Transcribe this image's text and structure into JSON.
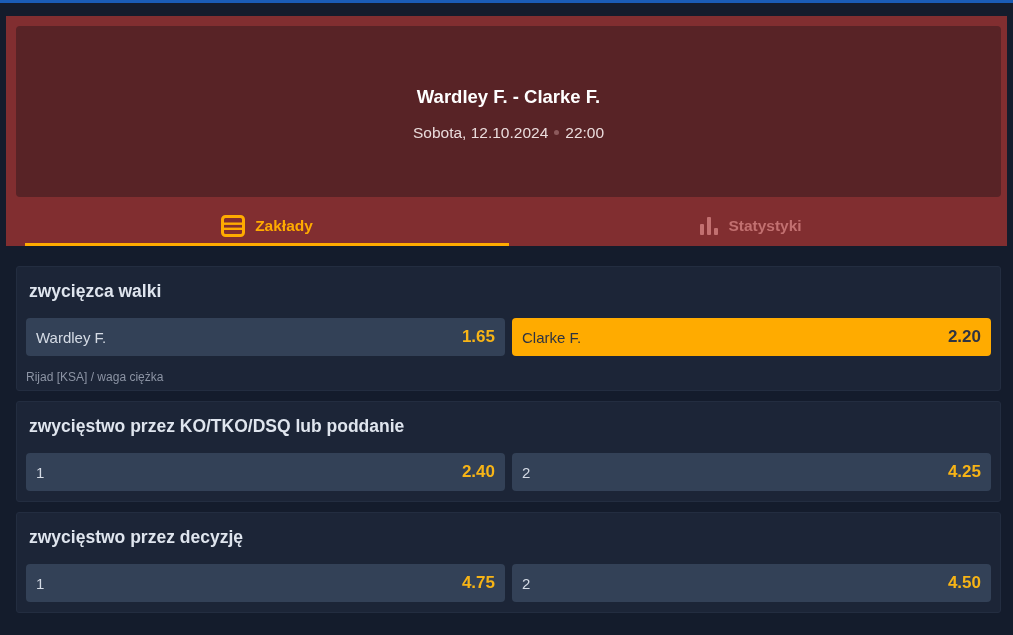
{
  "event": {
    "title": "Wardley F. - Clarke F.",
    "date": "Sobota, 12.10.2024",
    "time": "22:00"
  },
  "tabs": [
    {
      "kind": "bets",
      "label": "Zakłady",
      "selected": true
    },
    {
      "kind": "stats",
      "label": "Statystyki",
      "selected": false
    }
  ],
  "markets": [
    {
      "title": "zwycięzca walki",
      "options": [
        {
          "label": "Wardley F.",
          "odds": "1.65",
          "selected": false
        },
        {
          "label": "Clarke F.",
          "odds": "2.20",
          "selected": true
        }
      ],
      "note": "Rijad [KSA] / waga ciężka"
    },
    {
      "title": "zwycięstwo przez KO/TKO/DSQ lub poddanie",
      "options": [
        {
          "label": "1",
          "odds": "2.40",
          "selected": false
        },
        {
          "label": "2",
          "odds": "4.25",
          "selected": false
        }
      ]
    },
    {
      "title": "zwycięstwo przez decyzję",
      "options": [
        {
          "label": "1",
          "odds": "4.75",
          "selected": false
        },
        {
          "label": "2",
          "odds": "4.50",
          "selected": false
        }
      ]
    }
  ]
}
